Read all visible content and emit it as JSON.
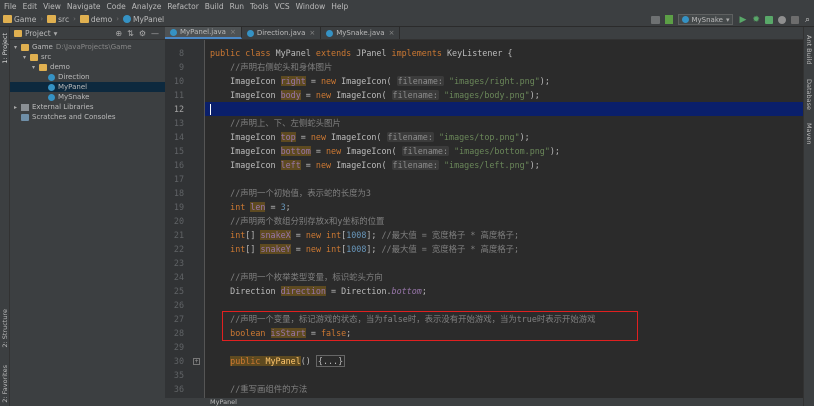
{
  "menu": [
    "File",
    "Edit",
    "View",
    "Navigate",
    "Code",
    "Analyze",
    "Refactor",
    "Build",
    "Run",
    "Tools",
    "VCS",
    "Window",
    "Help"
  ],
  "breadcrumbs": [
    "Game",
    "src",
    "demo",
    "MyPanel"
  ],
  "run_config": "MySnake",
  "project_panel": {
    "title": "Project",
    "tree": [
      {
        "label": "Game",
        "extra": "D:\\JavaProjects\\Game",
        "indent": 0,
        "arrow": "▾",
        "icon": "folder"
      },
      {
        "label": "src",
        "extra": "",
        "indent": 1,
        "arrow": "▾",
        "icon": "folder"
      },
      {
        "label": "demo",
        "extra": "",
        "indent": 2,
        "arrow": "▾",
        "icon": "folder"
      },
      {
        "label": "Direction",
        "extra": "",
        "indent": 3,
        "arrow": "",
        "icon": "class"
      },
      {
        "label": "MyPanel",
        "extra": "",
        "indent": 3,
        "arrow": "",
        "icon": "class",
        "selected": true
      },
      {
        "label": "MySnake",
        "extra": "",
        "indent": 3,
        "arrow": "",
        "icon": "class"
      },
      {
        "label": "External Libraries",
        "extra": "",
        "indent": 0,
        "arrow": "▸",
        "icon": "lib"
      },
      {
        "label": "Scratches and Consoles",
        "extra": "",
        "indent": 0,
        "arrow": "",
        "icon": "scratch"
      }
    ]
  },
  "left_tool_tabs": [
    "1: Project",
    "2: Structure",
    "2: Favorites"
  ],
  "right_tool_tabs": [
    "Ant Build",
    "Database",
    "Maven"
  ],
  "tabs": [
    {
      "label": "MyPanel.java",
      "active": true
    },
    {
      "label": "Direction.java",
      "active": false
    },
    {
      "label": "MySnake.java",
      "active": false
    }
  ],
  "line_numbers": [
    "8",
    "9",
    "10",
    "11",
    "12",
    "13",
    "14",
    "15",
    "16",
    "17",
    "18",
    "19",
    "20",
    "21",
    "22",
    "23",
    "24",
    "25",
    "26",
    "27",
    "28",
    "29",
    "30",
    "35",
    "36"
  ],
  "current_line": "12",
  "status_text": "MyPanel",
  "colors": {
    "keyword": "#cc7832",
    "comment": "#808080",
    "string": "#6a8759",
    "number": "#6897bb",
    "field": "#9876aa",
    "current_line_bg": "#0a1f6b",
    "highlight_box": "#e02020"
  }
}
